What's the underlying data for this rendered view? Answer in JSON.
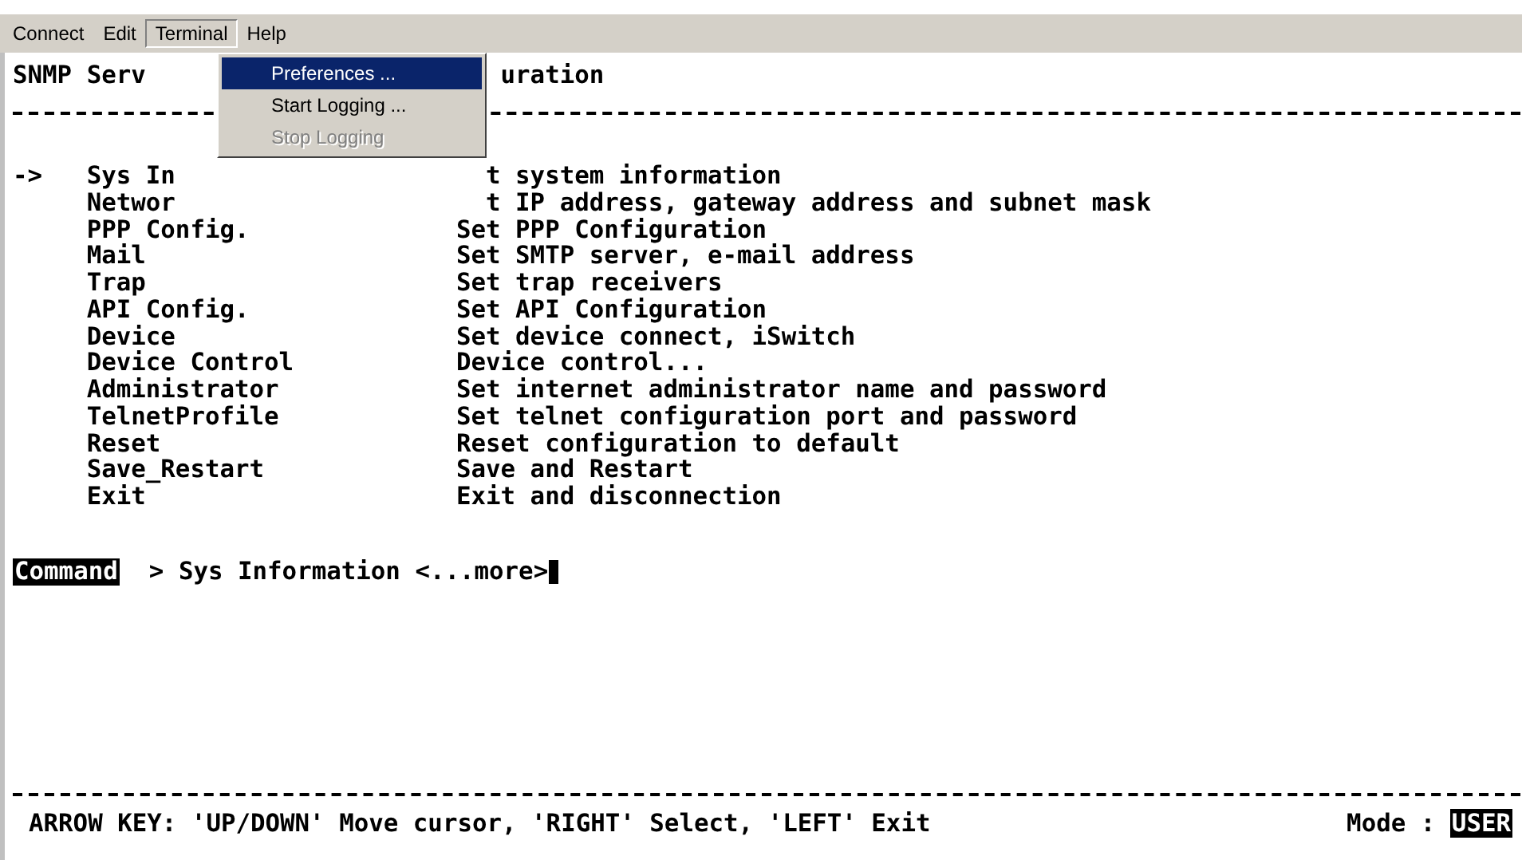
{
  "menu_bar": [
    {
      "label": "Connect",
      "open": false
    },
    {
      "label": "Edit",
      "open": false
    },
    {
      "label": "Terminal",
      "open": true
    },
    {
      "label": "Help",
      "open": false
    }
  ],
  "terminal_menu": [
    {
      "label": "Preferences ...",
      "selected": true,
      "disabled": false
    },
    {
      "label": "Start Logging ...",
      "selected": false,
      "disabled": false
    },
    {
      "label": "Stop Logging",
      "selected": false,
      "disabled": true
    }
  ],
  "screen": {
    "title_left": "SNMP Serv",
    "title_right": "uration",
    "cursor": "->",
    "items": [
      {
        "name": "Sys In",
        "description": "t system information",
        "selected": true,
        "covered": true
      },
      {
        "name": "Networ",
        "description": "t IP address, gateway address and subnet mask",
        "selected": false,
        "covered": true
      },
      {
        "name": "PPP Config.",
        "description": "Set PPP Configuration",
        "selected": false,
        "covered": false
      },
      {
        "name": "Mail",
        "description": "Set SMTP server, e-mail address",
        "selected": false,
        "covered": false
      },
      {
        "name": "Trap",
        "description": "Set trap receivers",
        "selected": false,
        "covered": false
      },
      {
        "name": "API Config.",
        "description": "Set API Configuration",
        "selected": false,
        "covered": false
      },
      {
        "name": "Device",
        "description": "Set device connect, iSwitch",
        "selected": false,
        "covered": false
      },
      {
        "name": "Device Control",
        "description": "Device control...",
        "selected": false,
        "covered": false
      },
      {
        "name": "Administrator",
        "description": "Set internet administrator name and password",
        "selected": false,
        "covered": false
      },
      {
        "name": "TelnetProfile",
        "description": "Set telnet configuration port and password",
        "selected": false,
        "covered": false
      },
      {
        "name": "Reset",
        "description": "Reset configuration to default",
        "selected": false,
        "covered": false
      },
      {
        "name": "Save_Restart",
        "description": "Save and Restart",
        "selected": false,
        "covered": false
      },
      {
        "name": "Exit",
        "description": "Exit and disconnection",
        "selected": false,
        "covered": false
      }
    ],
    "command_label": "Command",
    "command_text": "> Sys Information <...more>",
    "help_text": "ARROW KEY: 'UP/DOWN' Move cursor, 'RIGHT' Select, 'LEFT' Exit",
    "mode_label": "Mode :",
    "mode_value": "USER"
  }
}
